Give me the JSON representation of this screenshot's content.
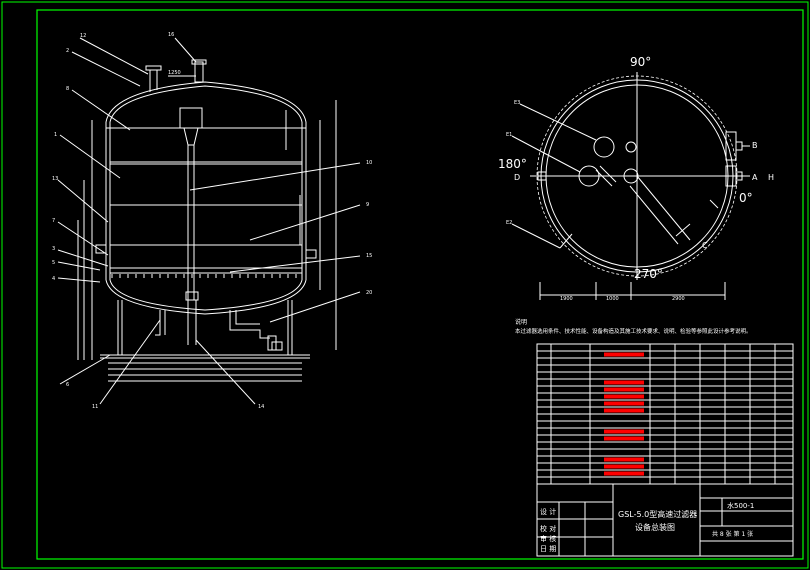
{
  "drawing": {
    "leaders_elevation": [
      "12",
      "2",
      "8",
      "1",
      "13",
      "7",
      "3",
      "5",
      "4",
      "16",
      "10",
      "9",
      "15",
      "20",
      "11",
      "14",
      "6"
    ],
    "dim_top": "1250",
    "plan_angles": [
      "90°",
      "180°",
      "0°",
      "270°"
    ],
    "plan_letters": [
      "B",
      "D",
      "A",
      "H",
      "C"
    ],
    "plan_leaders": [
      "E3",
      "E1",
      "E2"
    ],
    "plan_dims": [
      "1900",
      "1000",
      "2900"
    ],
    "notes_title": "说明",
    "notes_text": "本过滤器选用条件、技术性能、设备构造及其施工技术要求、说明、检验等参照此设计参考说明。",
    "title_block": {
      "title_line1": "GSL-5.0型高速过滤器",
      "title_line2": "设备总装图",
      "drawing_no": "水500-1",
      "sheet_label": "共 8 张   第 1 张",
      "left_labels": [
        "设 计",
        "校 对",
        "审 核",
        "日 期"
      ]
    }
  },
  "colors": {
    "frame": "#00ff00",
    "line": "#ffffff",
    "text": "#ffffff",
    "highlight": "#ff0000",
    "background": "#000000"
  }
}
